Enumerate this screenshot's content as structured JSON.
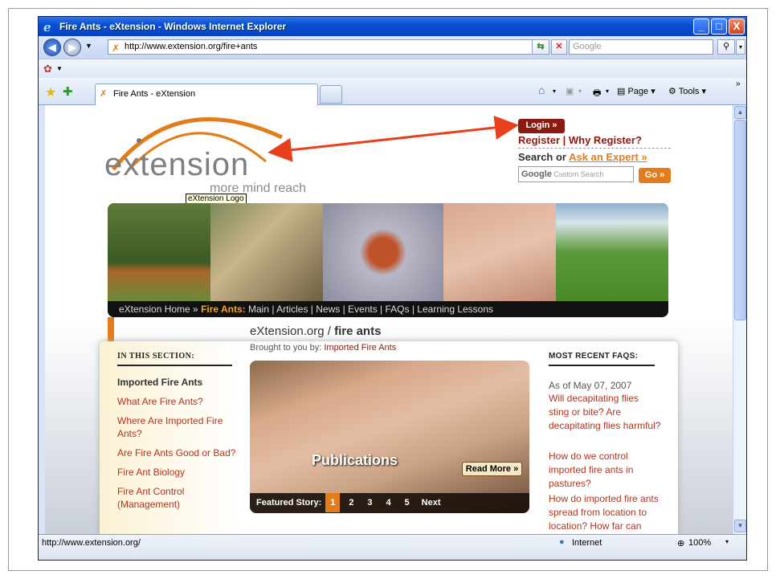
{
  "window": {
    "title": "Fire Ants - eXtension - Windows Internet Explorer",
    "controls": {
      "minimize": "_",
      "maximize": "□",
      "close": "X"
    }
  },
  "address": {
    "url": "http://www.extension.org/fire+ants",
    "search_placeholder": "Google"
  },
  "tabs": [
    {
      "label": "Fire Ants - eXtension"
    }
  ],
  "commands": {
    "page": "Page",
    "tools": "Tools"
  },
  "page": {
    "logo_text": "extension",
    "tagline": "more mind reach",
    "logo_tooltip": "eXtension Logo",
    "login": "Login »",
    "register": "Register | Why Register?",
    "search_or": "Search or",
    "ask_expert": "Ask an Expert »",
    "google_search_label": "Google",
    "google_search_hint": "Custom Search",
    "go": "Go »",
    "nav": {
      "home": "eXtension Home »",
      "section": "Fire Ants:",
      "links": "Main | Articles | News | Events | FAQs | Learning Lessons"
    },
    "title_site": "eXtension.org /",
    "title_topic": "fire ants",
    "brought_by": "Brought to you by:",
    "brought_by_org": "Imported Fire Ants",
    "section_header": "IN THIS SECTION:",
    "section_links": [
      "Imported Fire Ants",
      "What Are Fire Ants?",
      "Where Are Imported Fire Ants?",
      "Are Fire Ants Good or Bad?",
      "Fire Ant Biology",
      "Fire Ant Control (Management)"
    ],
    "feature": {
      "caption": "Publications",
      "read_more": "Read More »",
      "featured_label": "Featured Story:",
      "pages": [
        "1",
        "2",
        "3",
        "4",
        "5"
      ],
      "next": "Next"
    },
    "faqs": {
      "header": "MOST RECENT FAQS:",
      "date": "As of May 07, 2007",
      "items": [
        "Will decapitating flies sting or bite? Are decapitating flies harmful?",
        "How do we control imported fire ants in pastures?",
        "How do imported fire ants spread from location to location? How far can they travel?"
      ]
    }
  },
  "status": {
    "url": "http://www.extension.org/",
    "zone": "Internet",
    "zoom": "100%"
  },
  "colors": {
    "accent": "#e37d1b",
    "brand_red": "#8b1a12",
    "titlebar": "#0b4fd6"
  }
}
